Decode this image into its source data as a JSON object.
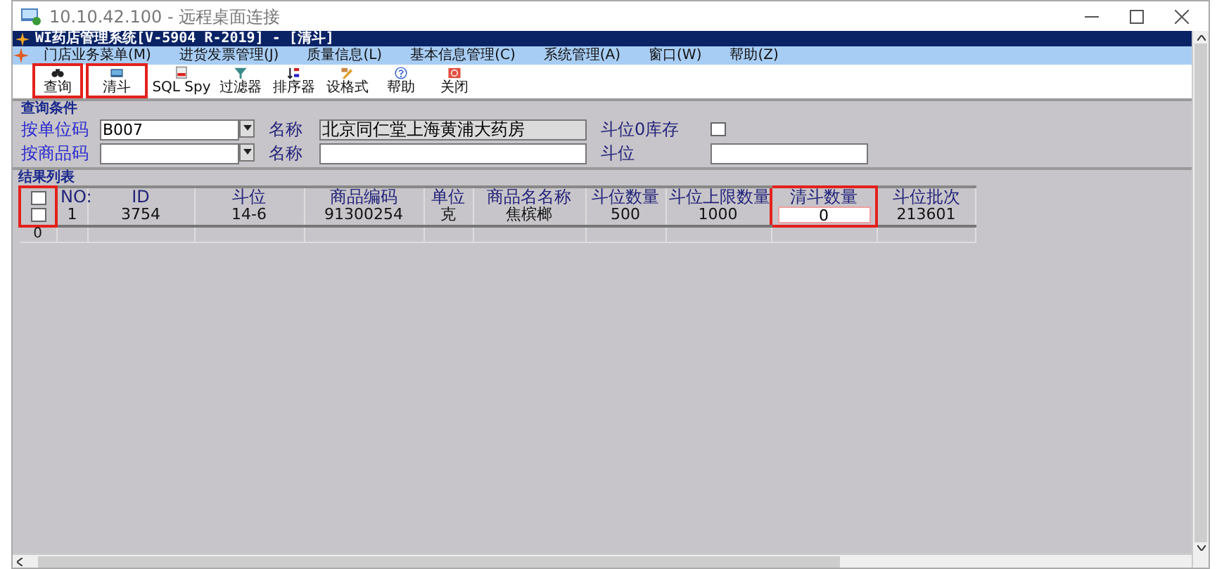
{
  "remote_window": {
    "title": "10.10.42.100 - 远程桌面连接"
  },
  "app": {
    "title": "WI药店管理系统[V-5904 R-2019] - [清斗]"
  },
  "menu": [
    {
      "label": "门店业务菜单(M)"
    },
    {
      "label": "进货发票管理(J)"
    },
    {
      "label": "质量信息(L)"
    },
    {
      "label": "基本信息管理(C)"
    },
    {
      "label": "系统管理(A)"
    },
    {
      "label": "窗口(W)"
    },
    {
      "label": "帮助(Z)"
    }
  ],
  "toolbar": [
    {
      "kind": "query",
      "label": "查询",
      "highlighted": true
    },
    {
      "kind": "clear",
      "label": "清斗",
      "highlighted": true
    },
    {
      "kind": "sql",
      "label": "SQL Spy",
      "highlighted": false
    },
    {
      "kind": "filter",
      "label": "过滤器",
      "highlighted": false
    },
    {
      "kind": "sort",
      "label": "排序器",
      "highlighted": false
    },
    {
      "kind": "format",
      "label": "设格式",
      "highlighted": false
    },
    {
      "kind": "help",
      "label": "帮助",
      "highlighted": false
    },
    {
      "kind": "close",
      "label": "关闭",
      "highlighted": false
    }
  ],
  "query": {
    "title": "查询条件",
    "unit_code": {
      "label": "按单位码",
      "value": "B007"
    },
    "unit_name": {
      "label": "名称",
      "value": "北京同仁堂上海黄浦大药房"
    },
    "zero_stock": {
      "label": "斗位0库存",
      "checked": false
    },
    "product_code": {
      "label": "按商品码"
    },
    "product_name": {
      "label": "名称"
    },
    "slot": {
      "label": "斗位"
    }
  },
  "results": {
    "title": "结果列表",
    "select_column": {
      "highlighted": true
    },
    "columns": [
      {
        "label": "NO:"
      },
      {
        "label": "ID"
      },
      {
        "label": "斗位"
      },
      {
        "label": "商品编码"
      },
      {
        "label": "单位"
      },
      {
        "label": "商品名名称"
      },
      {
        "label": "斗位数量"
      },
      {
        "label": "斗位上限数量"
      },
      {
        "label": "清斗数量",
        "kind": "input",
        "highlighted": true
      },
      {
        "label": "斗位批次"
      }
    ],
    "rows": [
      {
        "checked": false,
        "cells": [
          "1",
          "3754",
          "14-6",
          "91300254",
          "克",
          "焦槟榔",
          "500",
          "1000",
          "0",
          "213601"
        ]
      }
    ],
    "footer": "0"
  }
}
